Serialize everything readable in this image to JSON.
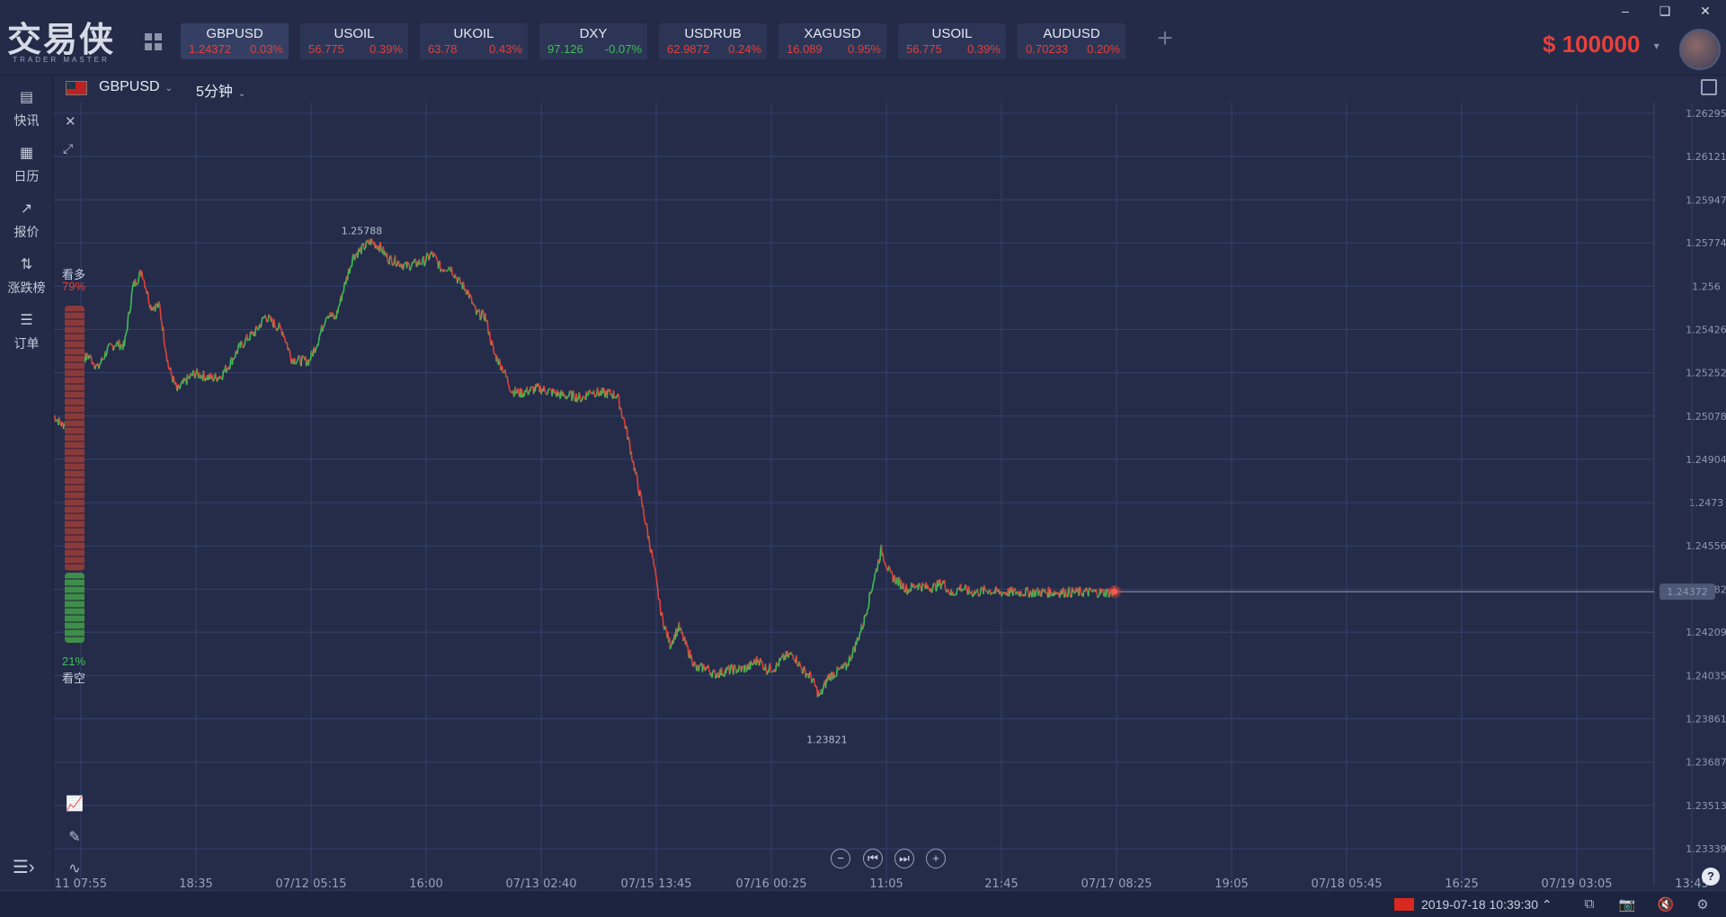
{
  "app": {
    "logo_main": "交易侠",
    "logo_sub": "TRADER MASTER",
    "balance_currency": "$",
    "balance_amount": "100000"
  },
  "tickers": [
    {
      "symbol": "GBPUSD",
      "price": "1.24372",
      "change": "0.03%",
      "dir": "up",
      "active": true
    },
    {
      "symbol": "USOIL",
      "price": "56.775",
      "change": "0.39%",
      "dir": "up"
    },
    {
      "symbol": "UKOIL",
      "price": "63.78",
      "change": "0.43%",
      "dir": "up"
    },
    {
      "symbol": "DXY",
      "price": "97.126",
      "change": "-0.07%",
      "dir": "down"
    },
    {
      "symbol": "USDRUB",
      "price": "62.9872",
      "change": "0.24%",
      "dir": "up"
    },
    {
      "symbol": "XAGUSD",
      "price": "16.089",
      "change": "0.95%",
      "dir": "up"
    },
    {
      "symbol": "USOIL",
      "price": "56.775",
      "change": "0.39%",
      "dir": "up"
    },
    {
      "symbol": "AUDUSD",
      "price": "0.70233",
      "change": "0.20%",
      "dir": "up"
    }
  ],
  "nav": [
    {
      "label": "快讯",
      "icon": "news-icon"
    },
    {
      "label": "日历",
      "icon": "calendar-icon"
    },
    {
      "label": "报价",
      "icon": "quote-icon"
    },
    {
      "label": "涨跌榜",
      "icon": "sort-icon"
    },
    {
      "label": "订单",
      "icon": "order-icon"
    }
  ],
  "chart_header": {
    "symbol": "GBPUSD",
    "timeframe": "5分钟"
  },
  "sentiment": {
    "bull_label": "看多",
    "bull_pct": "79%",
    "bear_label": "看空",
    "bear_pct": "21%"
  },
  "status": {
    "datetime": "2019-07-18 10:39:30"
  },
  "colors": {
    "bg": "#242c4a",
    "up": "#e2403a",
    "down": "#3fbf57",
    "grid": "#33406a"
  },
  "chart_data": {
    "type": "line",
    "y_ticks": [
      "1.26295",
      "1.26121",
      "1.25947",
      "1.25774",
      "1.256",
      "1.25426",
      "1.25252",
      "1.25078",
      "1.24904",
      "1.2473",
      "1.24556",
      "1.24382",
      "1.24209",
      "1.24035",
      "1.23861",
      "1.23687",
      "1.23513",
      "1.23339"
    ],
    "ylim": [
      1.23339,
      1.26295
    ],
    "x_ticks": [
      "11 07:55",
      "18:35",
      "07/12 05:15",
      "16:00",
      "07/13 02:40",
      "07/15 13:45",
      "07/16 00:25",
      "11:05",
      "21:45",
      "07/17 08:25",
      "19:05",
      "07/18 05:45",
      "16:25",
      "07/19 03:05",
      "13:45"
    ],
    "current_price": "1.24372",
    "high_label": "1.25788",
    "low_label": "1.23821",
    "series": [
      {
        "x": [
          0,
          10,
          20,
          30,
          40,
          50,
          60,
          70,
          80,
          90,
          100,
          110,
          120,
          130,
          140,
          150,
          160,
          170,
          180,
          190,
          200,
          210,
          220,
          230,
          240,
          250,
          260,
          270,
          280,
          290,
          300,
          310,
          320,
          330,
          340,
          350,
          360,
          370,
          380,
          390,
          400,
          410,
          420,
          430,
          440,
          450,
          460,
          470,
          480,
          490,
          500,
          510,
          520,
          530,
          540,
          550,
          560,
          570,
          580,
          590,
          600,
          610,
          620,
          630,
          640,
          650,
          660,
          670,
          680,
          690,
          700,
          710,
          720,
          730,
          740,
          750,
          760,
          770,
          780,
          790,
          800,
          810,
          820,
          830,
          840,
          850,
          860,
          870,
          880,
          890,
          900,
          910,
          920,
          930,
          940,
          950,
          960,
          970,
          980,
          990,
          1000,
          1010,
          1020,
          1030,
          1040,
          1050,
          1060,
          1070,
          1080,
          1090,
          1100,
          1110,
          1120,
          1130,
          1140,
          1150,
          1160,
          1170,
          1180,
          1190,
          1200,
          1205
        ],
        "y": [
          1.2508,
          1.2504,
          1.251,
          1.253,
          1.2532,
          1.2527,
          1.2534,
          1.2537,
          1.2536,
          1.256,
          1.2566,
          1.2552,
          1.2552,
          1.2528,
          1.2518,
          1.2522,
          1.2525,
          1.2524,
          1.2523,
          1.2524,
          1.2529,
          1.2535,
          1.2539,
          1.2542,
          1.2548,
          1.2545,
          1.2542,
          1.2531,
          1.253,
          1.253,
          1.2538,
          1.2549,
          1.2547,
          1.256,
          1.2572,
          1.2575,
          1.2578,
          1.2576,
          1.2571,
          1.257,
          1.2568,
          1.2569,
          1.257,
          1.2573,
          1.2567,
          1.2568,
          1.2562,
          1.2558,
          1.2549,
          1.2548,
          1.2533,
          1.2527,
          1.2518,
          1.2517,
          1.2518,
          1.2519,
          1.2518,
          1.2517,
          1.2516,
          1.2516,
          1.2515,
          1.2518,
          1.2517,
          1.2517,
          1.2516,
          1.2503,
          1.2486,
          1.2469,
          1.2451,
          1.2428,
          1.2416,
          1.2423,
          1.2414,
          1.2406,
          1.2407,
          1.2404,
          1.2405,
          1.2406,
          1.2406,
          1.2407,
          1.241,
          1.2406,
          1.2407,
          1.2411,
          1.2412,
          1.2406,
          1.2403,
          1.2395,
          1.2403,
          1.2405,
          1.2407,
          1.2415,
          1.2425,
          1.244,
          1.2454,
          1.2444,
          1.2441,
          1.2438,
          1.244,
          1.2439,
          1.2439,
          1.2441,
          1.2436,
          1.2439,
          1.2437,
          1.2437,
          1.2438,
          1.2437,
          1.2437,
          1.2437,
          1.2437,
          1.2437,
          1.2437,
          1.2437,
          1.2437,
          1.2437,
          1.2437,
          1.2437,
          1.2437,
          1.2437,
          1.2437,
          1.24372
        ]
      }
    ]
  }
}
